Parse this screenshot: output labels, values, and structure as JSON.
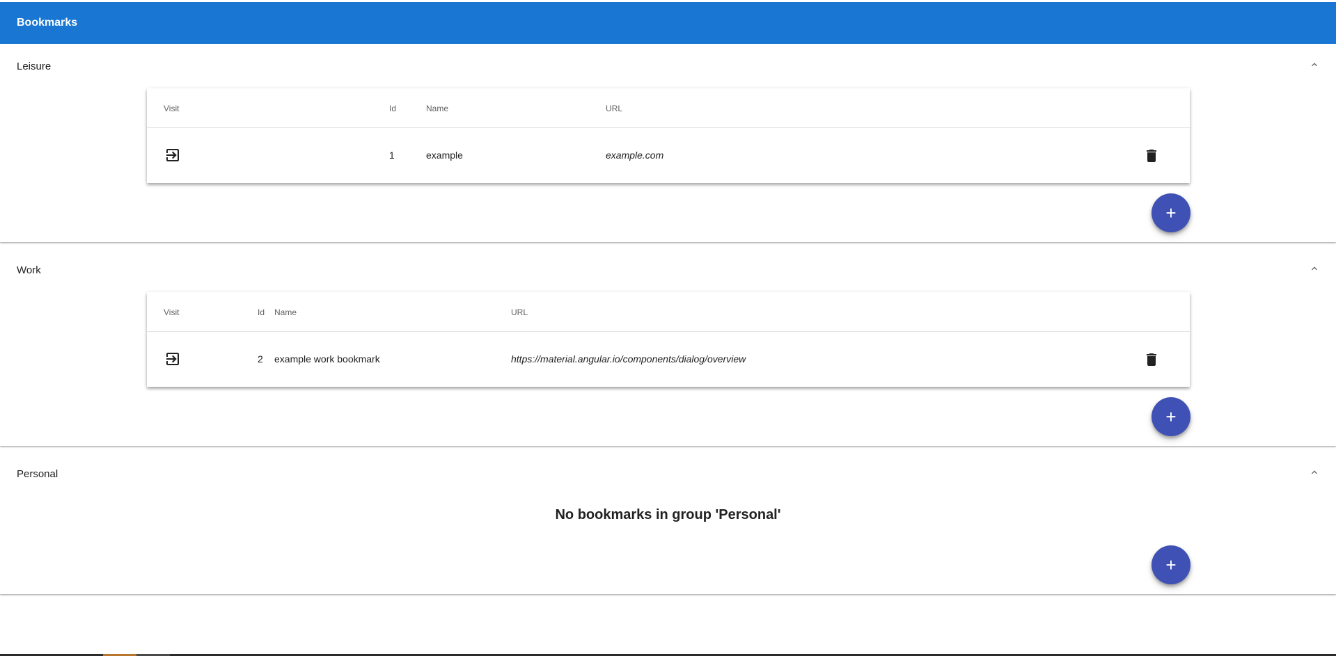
{
  "app": {
    "title": "Bookmarks"
  },
  "table_headers": {
    "visit": "Visit",
    "id": "Id",
    "name": "Name",
    "url": "URL"
  },
  "groups": [
    {
      "title": "Leisure",
      "expanded": true,
      "bookmarks": [
        {
          "id": "1",
          "name": "example",
          "url": "example.com"
        }
      ],
      "add_label": "+"
    },
    {
      "title": "Work",
      "expanded": true,
      "bookmarks": [
        {
          "id": "2",
          "name": "example work bookmark",
          "url": "https://material.angular.io/components/dialog/overview"
        }
      ],
      "add_label": "+"
    },
    {
      "title": "Personal",
      "expanded": true,
      "bookmarks": [],
      "empty_message": "No bookmarks in group 'Personal'",
      "add_label": "+"
    }
  ],
  "icons": {
    "visit": "login-icon",
    "delete": "trash-icon",
    "collapse": "chevron-up-icon",
    "add": "plus-icon"
  },
  "colors": {
    "primary": "#1976d2",
    "accent": "#3f51b5",
    "text": "#212121",
    "header_text": "#616161"
  }
}
